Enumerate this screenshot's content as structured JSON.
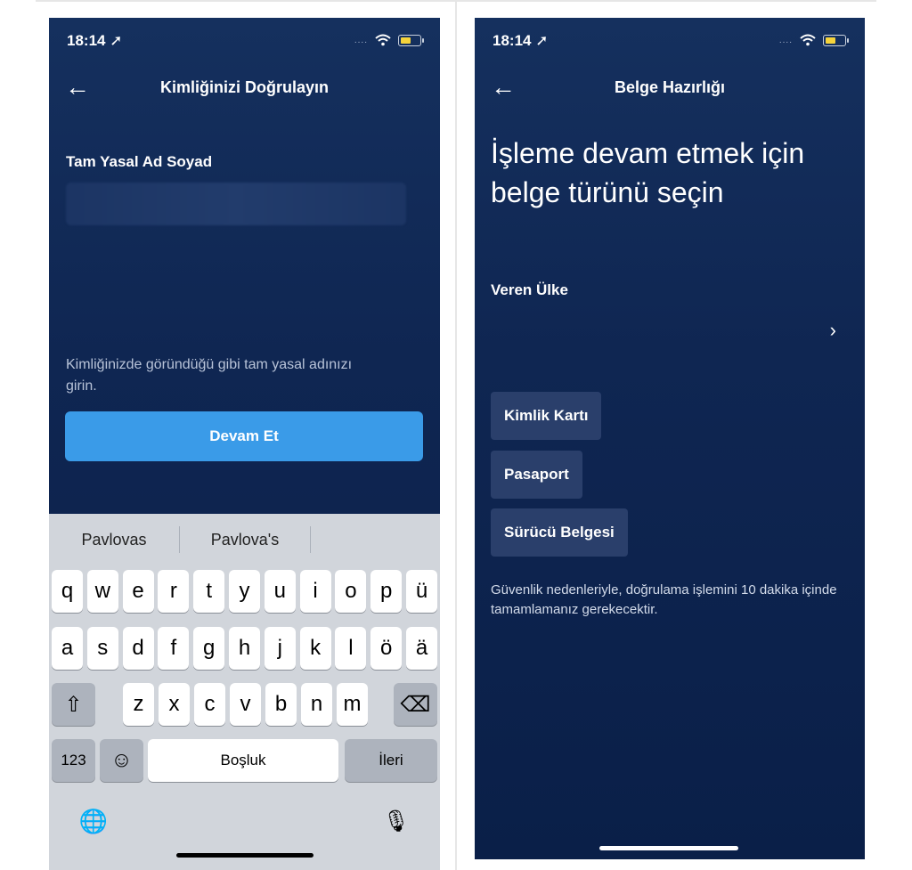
{
  "left": {
    "status_time": "18:14 ➚",
    "nav_back": "←",
    "title": "Kimliğinizi Doğrulayın",
    "field_label": "Tam Yasal Ad Soyad",
    "helper": "Kimliğinizde göründüğü gibi tam yasal adınızı girin.",
    "continue_label": "Devam Et",
    "keyboard": {
      "suggestions": [
        "Pavlovas",
        "Pavlova's"
      ],
      "row1": [
        "q",
        "w",
        "e",
        "r",
        "t",
        "y",
        "u",
        "i",
        "o",
        "p",
        "ü"
      ],
      "row2": [
        "a",
        "s",
        "d",
        "f",
        "g",
        "h",
        "j",
        "k",
        "l",
        "ö",
        "ä"
      ],
      "row3": [
        "z",
        "x",
        "c",
        "v",
        "b",
        "n",
        "m"
      ],
      "shift": "⇧",
      "backspace": "⌫",
      "numbers": "123",
      "emoji": "☺",
      "space": "Boşluk",
      "next": "İleri",
      "globe": "🌐",
      "mic": "🎙"
    }
  },
  "right": {
    "status_time": "18:14 ➚",
    "nav_back": "←",
    "title": "Belge Hazırlığı",
    "headline": "İşleme devam etmek için belge türünü seçin",
    "issuing_label": "Veren Ülke",
    "chevron": "›",
    "doc_types": [
      "Kimlik Kartı",
      "Pasaport",
      "Sürücü Belgesi"
    ],
    "notice": "Güvenlik nedenleriyle, doğrulama işlemini 10 dakika içinde tamamlamanız gerekecektir."
  },
  "status_icons": {
    "signal": "....",
    "wifi": "wifi-icon",
    "battery": "battery-icon"
  },
  "colors": {
    "background": "#0f2652",
    "primary_button": "#3a9be8",
    "doc_button": "#2a3f6b",
    "battery": "#f5d33b"
  }
}
